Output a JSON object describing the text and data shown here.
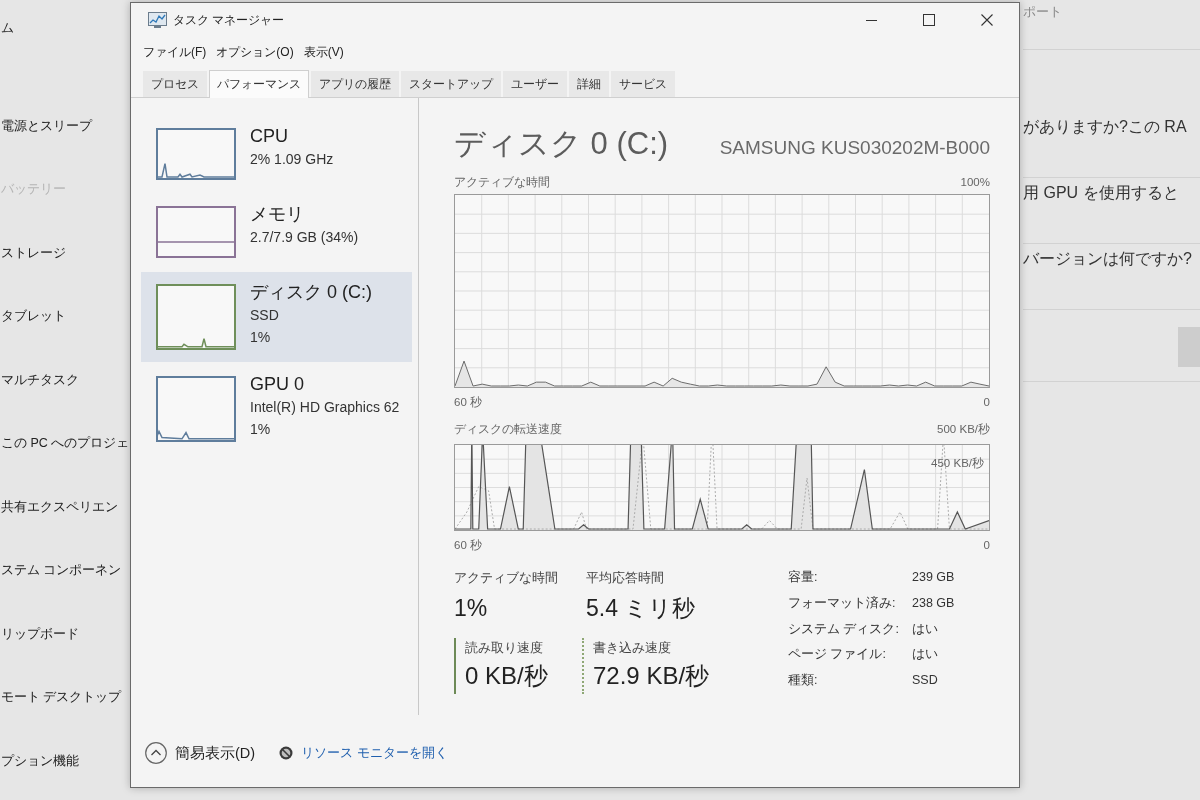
{
  "settings": {
    "nav_items": [
      {
        "label": "ム",
        "disabled": false
      },
      {
        "label": "電源とスリープ",
        "disabled": false
      },
      {
        "label": "バッテリー",
        "disabled": true
      },
      {
        "label": "ストレージ",
        "disabled": false
      },
      {
        "label": "タブレット",
        "disabled": false
      },
      {
        "label": "マルチタスク",
        "disabled": false
      },
      {
        "label": "この PC へのプロジェ",
        "disabled": false
      },
      {
        "label": "共有エクスペリエン",
        "disabled": false
      },
      {
        "label": "ステム コンポーネン",
        "disabled": false
      },
      {
        "label": "リップボード",
        "disabled": false
      },
      {
        "label": "モート デスクトップ",
        "disabled": false
      },
      {
        "label": "プション機能",
        "disabled": false
      }
    ],
    "top_text": "ポート",
    "questions": [
      "がありますか?この RA",
      "用 GPU を使用すると",
      "バージョンは何ですか?"
    ]
  },
  "window": {
    "title": "タスク マネージャー"
  },
  "menu": [
    "ファイル(F)",
    "オプション(O)",
    "表示(V)"
  ],
  "tabs": [
    {
      "label": "プロセス",
      "selected": false
    },
    {
      "label": "パフォーマンス",
      "selected": true
    },
    {
      "label": "アプリの履歴",
      "selected": false
    },
    {
      "label": "スタートアップ",
      "selected": false
    },
    {
      "label": "ユーザー",
      "selected": false
    },
    {
      "label": "詳細",
      "selected": false
    },
    {
      "label": "サービス",
      "selected": false
    }
  ],
  "devices": [
    {
      "name": "CPU",
      "details": [
        "2% 1.09 GHz"
      ],
      "kind": "usage",
      "color": "#5f7d9c",
      "selected": false
    },
    {
      "name": "メモリ",
      "details": [
        "2.7/7.9 GB (34%)"
      ],
      "kind": "memory",
      "color": "#8a7396",
      "selected": false
    },
    {
      "name": "ディスク 0 (C:)",
      "details": [
        "SSD",
        "1%"
      ],
      "kind": "usage",
      "color": "#6f8f5a",
      "selected": true
    },
    {
      "name": "GPU 0",
      "details": [
        "Intel(R) HD Graphics 62",
        "1%"
      ],
      "kind": "usage",
      "color": "#5f7d9c",
      "selected": false
    }
  ],
  "detail": {
    "title": "ディスク 0 (C:)",
    "model": "SAMSUNG KUS030202M-B000",
    "active_graph": {
      "label": "アクティブな時間",
      "max": "100%",
      "start": "60 秒",
      "end": "0"
    },
    "transfer_graph": {
      "label": "ディスクの転送速度",
      "max": "500 KB/秒",
      "inner_label": "450 KB/秒",
      "start": "60 秒",
      "end": "0"
    },
    "stats": [
      {
        "label": "アクティブな時間",
        "value": "1%"
      },
      {
        "label": "平均応答時間",
        "value": "5.4 ミリ秒"
      }
    ],
    "rates": [
      {
        "label": "読み取り速度",
        "value": "0 KB/秒",
        "kind": "solid"
      },
      {
        "label": "書き込み速度",
        "value": "72.9 KB/秒",
        "kind": "dotted"
      }
    ],
    "properties": [
      {
        "label": "容量:",
        "value": "239 GB"
      },
      {
        "label": "フォーマット済み:",
        "value": "238 GB"
      },
      {
        "label": "システム ディスク:",
        "value": "はい"
      },
      {
        "label": "ページ ファイル:",
        "value": "はい"
      },
      {
        "label": "種類:",
        "value": "SSD"
      }
    ]
  },
  "footer": {
    "fewer_details": "簡易表示(D)",
    "resource_monitor": "リソース モニターを開く"
  }
}
